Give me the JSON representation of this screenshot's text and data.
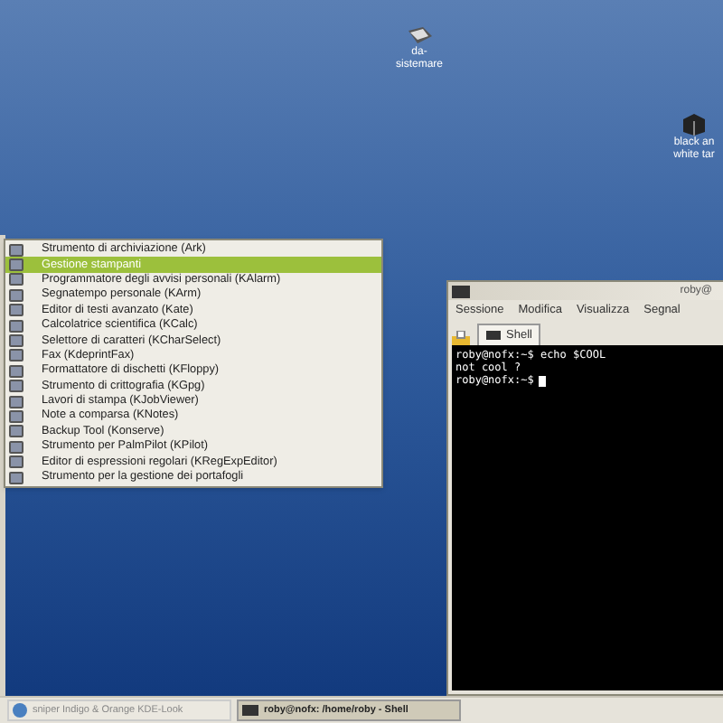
{
  "desktop_icons": [
    {
      "lines": [
        "da-",
        "sistemare"
      ],
      "kind": "drive"
    },
    {
      "lines": [
        "black an",
        "white tar"
      ],
      "kind": "archive"
    }
  ],
  "menu": {
    "items": [
      {
        "label": "Strumento di archiviazione (Ark)",
        "selected": false
      },
      {
        "label": "Gestione stampanti",
        "selected": true
      },
      {
        "label": "Programmatore degli avvisi personali (KAlarm)",
        "selected": false
      },
      {
        "label": "Segnatempo personale (KArm)",
        "selected": false
      },
      {
        "label": "Editor di testi avanzato (Kate)",
        "selected": false
      },
      {
        "label": "Calcolatrice scientifica (KCalc)",
        "selected": false
      },
      {
        "label": "Selettore di caratteri (KCharSelect)",
        "selected": false
      },
      {
        "label": "Fax (KdeprintFax)",
        "selected": false
      },
      {
        "label": "Formattatore di dischetti (KFloppy)",
        "selected": false
      },
      {
        "label": "Strumento di crittografia (KGpg)",
        "selected": false
      },
      {
        "label": "Lavori di stampa (KJobViewer)",
        "selected": false
      },
      {
        "label": "Note a comparsa (KNotes)",
        "selected": false
      },
      {
        "label": "Backup Tool (Konserve)",
        "selected": false
      },
      {
        "label": "Strumento per PalmPilot (KPilot)",
        "selected": false
      },
      {
        "label": "Editor di espressioni regolari (KRegExpEditor)",
        "selected": false
      },
      {
        "label": "Strumento per la gestione dei portafogli",
        "selected": false
      }
    ]
  },
  "terminal": {
    "title": "roby@",
    "menu": [
      "Sessione",
      "Modifica",
      "Visualizza",
      "Segnal"
    ],
    "tab": "Shell",
    "lines": [
      "roby@nofx:~$ echo $COOL",
      "not cool ?",
      "roby@nofx:~$"
    ]
  },
  "taskbar": {
    "tasks": [
      {
        "label": "sniper Indigo & Orange KDE-Look",
        "selected": false
      },
      {
        "label": "roby@nofx: /home/roby - Shell",
        "selected": true
      }
    ]
  }
}
